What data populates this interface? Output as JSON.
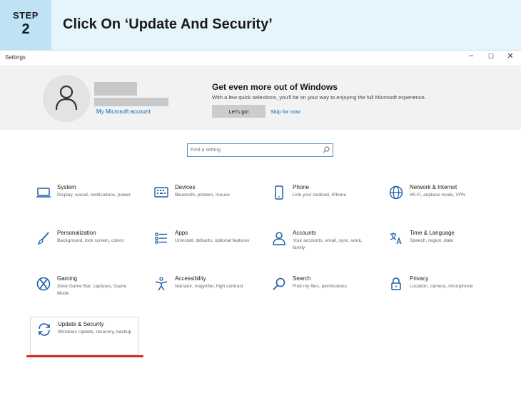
{
  "banner": {
    "step_label": "STEP",
    "step_number": "2",
    "title": "Click On ‘Update And Security’"
  },
  "window": {
    "title": "Settings",
    "controls": {
      "minimize": "–",
      "maximize": "☐",
      "close": "✕"
    }
  },
  "hero": {
    "account_link": "My Microsoft account",
    "title": "Get even more out of Windows",
    "description": "With a few quick selections, you'll be on your way to enjoying the full Microsoft experience.",
    "primary_button": "Let's go!",
    "secondary_link": "Skip for now"
  },
  "search": {
    "placeholder": "Find a setting"
  },
  "tiles": [
    {
      "title": "System",
      "desc": "Display, sound, notifications, power",
      "icon": "laptop-icon"
    },
    {
      "title": "Devices",
      "desc": "Bluetooth, printers, mouse",
      "icon": "keyboard-icon"
    },
    {
      "title": "Phone",
      "desc": "Link your Android, iPhone",
      "icon": "phone-icon"
    },
    {
      "title": "Network & Internet",
      "desc": "Wi-Fi, airplane mode, VPN",
      "icon": "globe-icon"
    },
    {
      "title": "Personalization",
      "desc": "Background, lock screen, colors",
      "icon": "brush-icon"
    },
    {
      "title": "Apps",
      "desc": "Uninstall, defaults, optional features",
      "icon": "apps-list-icon"
    },
    {
      "title": "Accounts",
      "desc": "Your accounts, email, sync, work, family",
      "icon": "person-icon"
    },
    {
      "title": "Time & Language",
      "desc": "Speech, region, date",
      "icon": "language-icon"
    },
    {
      "title": "Gaming",
      "desc": "Xbox Game Bar, captures, Game Mode",
      "icon": "xbox-icon"
    },
    {
      "title": "Accessibility",
      "desc": "Narrator, magnifier, high contrast",
      "icon": "accessibility-icon"
    },
    {
      "title": "Search",
      "desc": "Find my files, permissions",
      "icon": "search-icon"
    },
    {
      "title": "Privacy",
      "desc": "Location, camera, microphone",
      "icon": "lock-icon"
    },
    {
      "title": "Update & Security",
      "desc": "Windows Update, recovery, backup",
      "icon": "sync-icon"
    }
  ],
  "colors": {
    "accent": "#0067b8",
    "icon_blue": "#1f5fa8",
    "highlight_underline": "#d22a2a",
    "banner_bg": "#e6f4fb",
    "step_box_bg": "#bfe3f5"
  }
}
